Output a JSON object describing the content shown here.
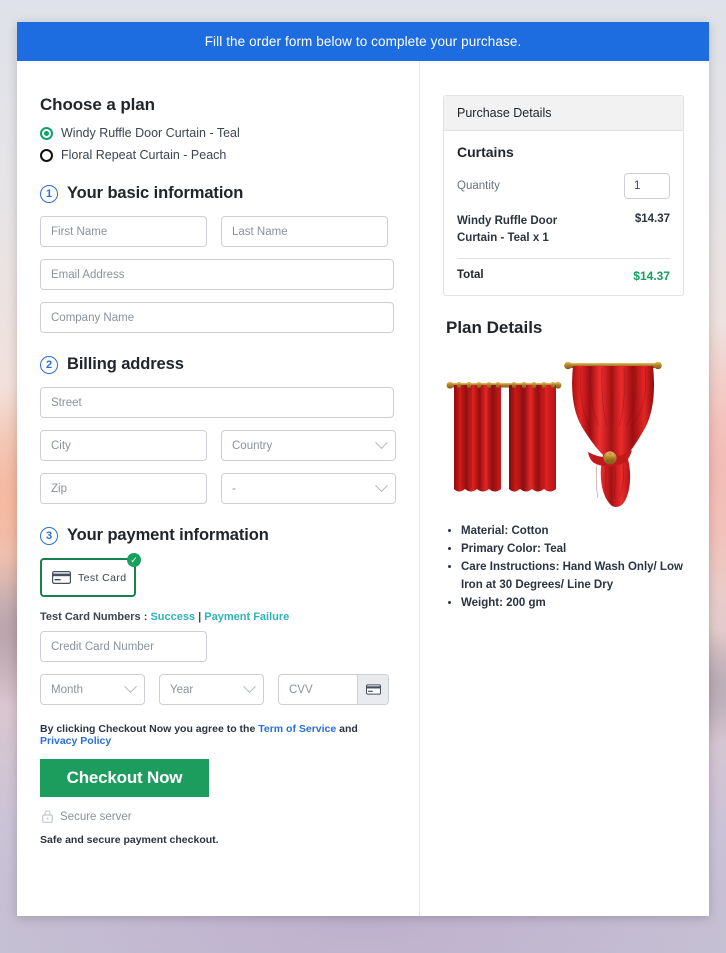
{
  "banner": {
    "text": "Fill the order form below to complete your purchase."
  },
  "plan": {
    "heading": "Choose a plan",
    "options": [
      {
        "label": "Windy Ruffle Door Curtain - Teal",
        "selected": true
      },
      {
        "label": "Floral Repeat Curtain - Peach",
        "selected": false
      }
    ]
  },
  "step1": {
    "number": "1",
    "title": "Your basic information",
    "first_name_placeholder": "First Name",
    "last_name_placeholder": "Last Name",
    "email_placeholder": "Email Address",
    "company_placeholder": "Company Name"
  },
  "step2": {
    "number": "2",
    "title": "Billing address",
    "street_placeholder": "Street",
    "city_placeholder": "City",
    "country_value": "Country",
    "zip_placeholder": "Zip",
    "state_value": "-"
  },
  "step3": {
    "number": "3",
    "title": "Your payment information",
    "test_card_label": "Test Card",
    "test_card_numbers_prefix": "Test Card Numbers : ",
    "link_success": "Success",
    "link_separator": " | ",
    "link_failure": "Payment Failure",
    "card_number_placeholder": "Credit Card Number",
    "month_value": "Month",
    "year_value": "Year",
    "cvv_placeholder": "CVV"
  },
  "footer": {
    "agree_prefix": "By clicking Checkout Now you agree to the ",
    "terms_link": "Term of Service",
    "agree_mid": " and ",
    "privacy_link": "Privacy Policy",
    "checkout_label": "Checkout Now",
    "secure_server": "Secure server",
    "safe_note": "Safe and secure payment checkout."
  },
  "purchase": {
    "header": "Purchase Details",
    "product": "Curtains",
    "quantity_label": "Quantity",
    "quantity_value": "1",
    "line_item_name": "Windy Ruffle Door Curtain - Teal x 1",
    "line_item_price": "$14.37",
    "total_label": "Total",
    "total_value": "$14.37"
  },
  "plan_details": {
    "title": "Plan Details",
    "specs": [
      "Material: Cotton",
      "Primary Color: Teal",
      "Care Instructions: Hand Wash Only/ Low Iron at 30 Degrees/ Line Dry",
      "Weight: 200 gm"
    ]
  },
  "colors": {
    "banner_blue": "#1d6ce0",
    "accent_green": "#1c9d5e",
    "link_teal": "#2fb3b8",
    "link_blue": "#2a6fd6",
    "total_green": "#12a05d"
  }
}
